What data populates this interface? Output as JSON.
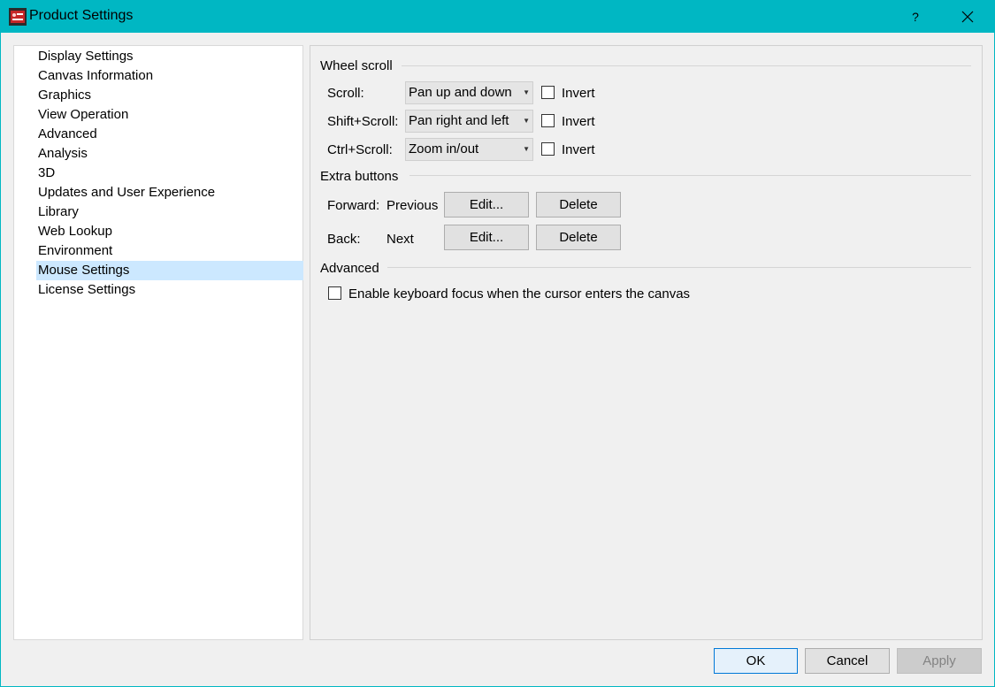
{
  "window": {
    "title": "Product Settings",
    "help_label": "?",
    "close_label": "✕",
    "accent_color": "#00b7c3"
  },
  "nav": {
    "items": [
      {
        "label": "Display Settings"
      },
      {
        "label": "Canvas Information"
      },
      {
        "label": "Graphics"
      },
      {
        "label": "View Operation"
      },
      {
        "label": "Advanced"
      },
      {
        "label": "Analysis"
      },
      {
        "label": "3D"
      },
      {
        "label": "Updates and User Experience"
      },
      {
        "label": "Library"
      },
      {
        "label": "Web Lookup"
      },
      {
        "label": "Environment"
      },
      {
        "label": "Mouse Settings",
        "selected": true
      },
      {
        "label": "License Settings"
      }
    ]
  },
  "wheel_scroll": {
    "title": "Wheel scroll",
    "rows": [
      {
        "label": "Scroll:",
        "value": "Pan up and down",
        "invert_label": "Invert",
        "invert": false
      },
      {
        "label": "Shift+Scroll:",
        "value": "Pan right and left",
        "invert_label": "Invert",
        "invert": false
      },
      {
        "label": "Ctrl+Scroll:",
        "value": "Zoom in/out",
        "invert_label": "Invert",
        "invert": false
      }
    ]
  },
  "extra_buttons": {
    "title": "Extra buttons",
    "rows": [
      {
        "label": "Forward:",
        "value": "Previous",
        "edit_label": "Edit...",
        "delete_label": "Delete"
      },
      {
        "label": "Back:",
        "value": "Next",
        "edit_label": "Edit...",
        "delete_label": "Delete"
      }
    ]
  },
  "advanced": {
    "title": "Advanced",
    "keyboard_focus_label": "Enable keyboard focus when the cursor enters the canvas",
    "keyboard_focus": false
  },
  "footer": {
    "ok_label": "OK",
    "cancel_label": "Cancel",
    "apply_label": "Apply"
  }
}
